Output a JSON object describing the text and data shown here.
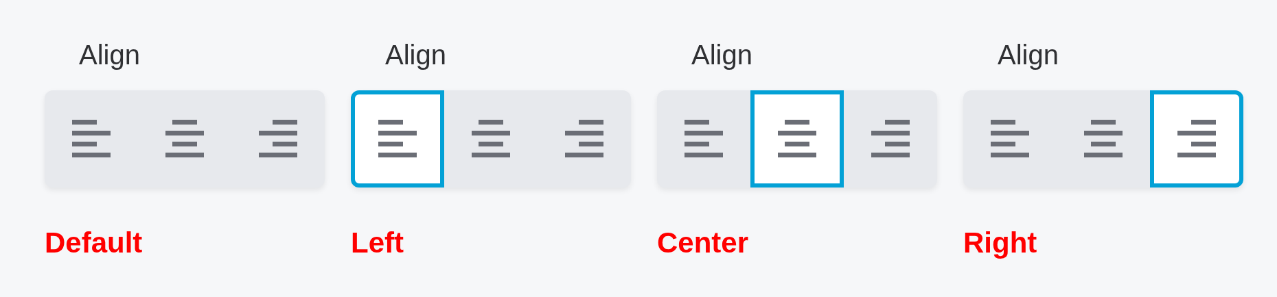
{
  "examples": [
    {
      "label": "Align",
      "buttons": [
        {
          "kind": "left",
          "selected": false
        },
        {
          "kind": "center",
          "selected": false
        },
        {
          "kind": "right",
          "selected": false
        }
      ],
      "caption": "Default"
    },
    {
      "label": "Align",
      "buttons": [
        {
          "kind": "left",
          "selected": true
        },
        {
          "kind": "center",
          "selected": false
        },
        {
          "kind": "right",
          "selected": false
        }
      ],
      "caption": "Left"
    },
    {
      "label": "Align",
      "buttons": [
        {
          "kind": "left",
          "selected": false
        },
        {
          "kind": "center",
          "selected": true
        },
        {
          "kind": "right",
          "selected": false
        }
      ],
      "caption": "Center"
    },
    {
      "label": "Align",
      "buttons": [
        {
          "kind": "left",
          "selected": false
        },
        {
          "kind": "center",
          "selected": false
        },
        {
          "kind": "right",
          "selected": true
        }
      ],
      "caption": "Right"
    }
  ]
}
